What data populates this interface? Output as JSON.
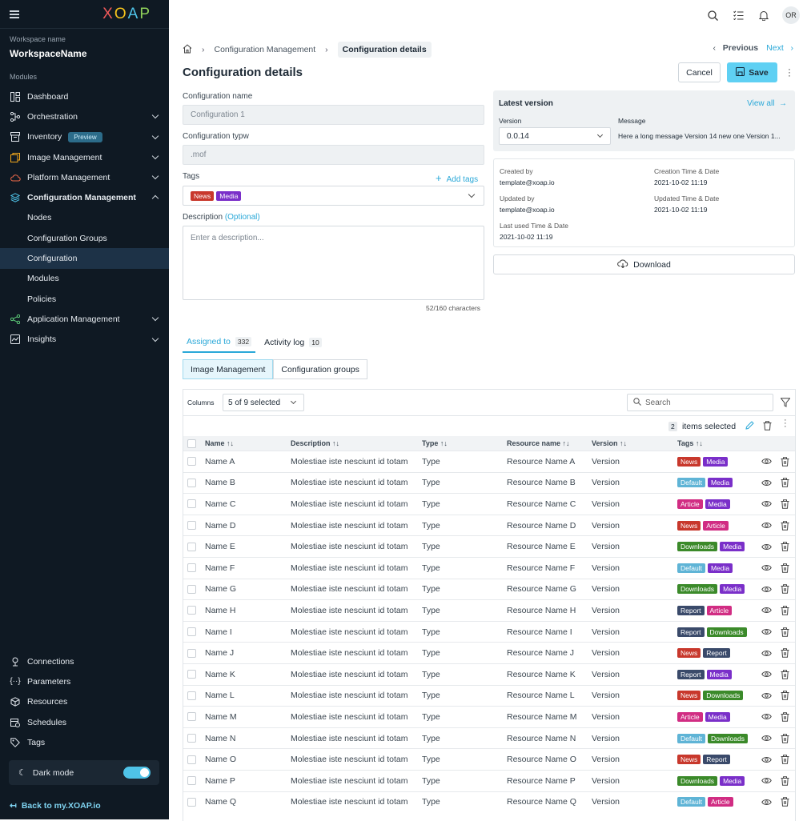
{
  "sidebar": {
    "logo": [
      "X",
      "O",
      "A",
      "P"
    ],
    "workspace_label": "Workspace name",
    "workspace_name": "WorkspaceName",
    "modules_label": "Modules",
    "items": [
      {
        "label": "Dashboard",
        "icon": "dashboard-icon"
      },
      {
        "label": "Orchestration",
        "icon": "orchestration-icon",
        "chevron": "down"
      },
      {
        "label": "Inventory",
        "icon": "inventory-icon",
        "badge": "Preview",
        "chevron": "down"
      },
      {
        "label": "Image Management",
        "icon": "image-icon",
        "chevron": "down"
      },
      {
        "label": "Platform Management",
        "icon": "cloud-icon",
        "chevron": "down"
      },
      {
        "label": "Configuration Management",
        "icon": "layers-icon",
        "chevron": "up"
      }
    ],
    "sub_items": [
      "Nodes",
      "Configuration Groups",
      "Configuration",
      "Modules",
      "Policies"
    ],
    "items2": [
      {
        "label": "Application Management",
        "icon": "share-icon",
        "chevron": "down"
      },
      {
        "label": "Insights",
        "icon": "insights-icon",
        "chevron": "down"
      }
    ],
    "bottom_items": [
      {
        "label": "Connections",
        "icon": "connections-icon"
      },
      {
        "label": "Parameters",
        "icon": "parameters-icon"
      },
      {
        "label": "Resources",
        "icon": "cube-icon"
      },
      {
        "label": "Schedules",
        "icon": "calendar-icon"
      },
      {
        "label": "Tags",
        "icon": "tag-icon"
      }
    ],
    "dark_mode": "Dark mode",
    "back": "Back to my.XOAP.io"
  },
  "topbar": {
    "avatar": "OR"
  },
  "breadcrumb": {
    "parent": "Configuration Management",
    "current": "Configuration details"
  },
  "pager": {
    "prev": "Previous",
    "next": "Next"
  },
  "title": "Configuration details",
  "buttons": {
    "cancel": "Cancel",
    "save": "Save"
  },
  "form": {
    "name_label": "Configuration name",
    "name_value": "Configuration 1",
    "type_label": "Configuration typw",
    "type_value": ".mof",
    "tags_label": "Tags",
    "add_tags": "Add tags",
    "tags": [
      {
        "text": "News",
        "color": "#c8382c"
      },
      {
        "text": "Media",
        "color": "#7a2fc9"
      }
    ],
    "desc_label": "Description",
    "desc_optional": "(Optional)",
    "desc_placeholder": "Enter a description...",
    "char_count": "52/160 characters"
  },
  "latest": {
    "title": "Latest version",
    "view_all": "View all",
    "version_label": "Version",
    "version_value": "0.0.14",
    "message_label": "Message",
    "message_value": "Here a long message Version 14 new one Version 1..."
  },
  "meta": {
    "created_by_label": "Created by",
    "created_by": "template@xoap.io",
    "created_time_label": "Creation Time & Date",
    "created_time": "2021-10-02 11:19",
    "updated_by_label": "Updated by",
    "updated_by": "template@xoap.io",
    "updated_time_label": "Updated Time & Date",
    "updated_time": "2021-10-02 11:19",
    "last_used_label": "Last used Time & Date",
    "last_used": "2021-10-02 11:19"
  },
  "download": "Download",
  "tabs": [
    {
      "label": "Assigned to",
      "count": "332"
    },
    {
      "label": "Activity log",
      "count": "10"
    }
  ],
  "segments": [
    "Image Management",
    "Configuration groups"
  ],
  "table": {
    "columns_label": "Columns",
    "columns_value": "5 of 9 selected",
    "search_placeholder": "Search",
    "selected_count": "2",
    "selected_text": "items selected",
    "headers": [
      "Name",
      "Description",
      "Type",
      "Resource name",
      "Version",
      "Tags"
    ],
    "rows": [
      {
        "name": "Name A",
        "desc": "Molestiae iste nesciunt id totam",
        "type": "Type",
        "res": "Resource Name A",
        "ver": "Version",
        "tags": [
          "News",
          "Media"
        ]
      },
      {
        "name": "Name B",
        "desc": "Molestiae iste nesciunt id totam",
        "type": "Type",
        "res": "Resource Name B",
        "ver": "Version",
        "tags": [
          "Default",
          "Media"
        ]
      },
      {
        "name": "Name C",
        "desc": "Molestiae iste nesciunt id totam",
        "type": "Type",
        "res": "Resource Name C",
        "ver": "Version",
        "tags": [
          "Article",
          "Media"
        ]
      },
      {
        "name": "Name D",
        "desc": "Molestiae iste nesciunt id totam",
        "type": "Type",
        "res": "Resource Name D",
        "ver": "Version",
        "tags": [
          "News",
          "Article"
        ]
      },
      {
        "name": "Name E",
        "desc": "Molestiae iste nesciunt id totam",
        "type": "Type",
        "res": "Resource Name E",
        "ver": "Version",
        "tags": [
          "Downloads",
          "Media"
        ]
      },
      {
        "name": "Name F",
        "desc": "Molestiae iste nesciunt id totam",
        "type": "Type",
        "res": "Resource Name F",
        "ver": "Version",
        "tags": [
          "Default",
          "Media"
        ]
      },
      {
        "name": "Name G",
        "desc": "Molestiae iste nesciunt id totam",
        "type": "Type",
        "res": "Resource Name G",
        "ver": "Version",
        "tags": [
          "Downloads",
          "Media"
        ]
      },
      {
        "name": "Name H",
        "desc": "Molestiae iste nesciunt id totam",
        "type": "Type",
        "res": "Resource Name H",
        "ver": "Version",
        "tags": [
          "Report",
          "Article"
        ]
      },
      {
        "name": "Name I",
        "desc": "Molestiae iste nesciunt id totam",
        "type": "Type",
        "res": "Resource Name I",
        "ver": "Version",
        "tags": [
          "Report",
          "Downloads"
        ]
      },
      {
        "name": "Name J",
        "desc": "Molestiae iste nesciunt id totam",
        "type": "Type",
        "res": "Resource Name J",
        "ver": "Version",
        "tags": [
          "News",
          "Report"
        ]
      },
      {
        "name": "Name K",
        "desc": "Molestiae iste nesciunt id totam",
        "type": "Type",
        "res": "Resource Name K",
        "ver": "Version",
        "tags": [
          "Report",
          "Media"
        ]
      },
      {
        "name": "Name L",
        "desc": "Molestiae iste nesciunt id totam",
        "type": "Type",
        "res": "Resource Name L",
        "ver": "Version",
        "tags": [
          "News",
          "Downloads"
        ]
      },
      {
        "name": "Name M",
        "desc": "Molestiae iste nesciunt id totam",
        "type": "Type",
        "res": "Resource Name M",
        "ver": "Version",
        "tags": [
          "Article",
          "Media"
        ]
      },
      {
        "name": "Name N",
        "desc": "Molestiae iste nesciunt id totam",
        "type": "Type",
        "res": "Resource Name N",
        "ver": "Version",
        "tags": [
          "Default",
          "Downloads"
        ]
      },
      {
        "name": "Name O",
        "desc": "Molestiae iste nesciunt id totam",
        "type": "Type",
        "res": "Resource Name O",
        "ver": "Version",
        "tags": [
          "News",
          "Report"
        ]
      },
      {
        "name": "Name P",
        "desc": "Molestiae iste nesciunt id totam",
        "type": "Type",
        "res": "Resource Name P",
        "ver": "Version",
        "tags": [
          "Downloads",
          "Media"
        ]
      },
      {
        "name": "Name Q",
        "desc": "Molestiae iste nesciunt id totam",
        "type": "Type",
        "res": "Resource Name Q",
        "ver": "Version",
        "tags": [
          "Default",
          "Article"
        ]
      }
    ]
  },
  "tag_colors": {
    "News": "#c8382c",
    "Media": "#7a2fc9",
    "Default": "#5fb4d6",
    "Article": "#d12d83",
    "Downloads": "#3b8a2a",
    "Report": "#3a4a6a"
  }
}
